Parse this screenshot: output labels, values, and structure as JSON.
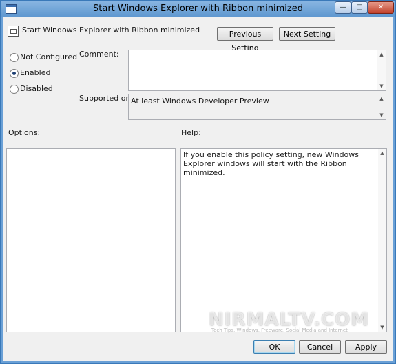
{
  "window": {
    "title": "Start Windows Explorer with Ribbon minimized",
    "icon": "policy-app-icon",
    "controls": {
      "minimize": "—",
      "maximize": "□",
      "close": "✕"
    }
  },
  "policy": {
    "title": "Start Windows Explorer with Ribbon minimized",
    "icon": "policy-setting-icon"
  },
  "nav": {
    "previous": "Previous Setting",
    "next": "Next Setting"
  },
  "state": {
    "options": [
      {
        "label": "Not Configured",
        "selected": false
      },
      {
        "label": "Enabled",
        "selected": true
      },
      {
        "label": "Disabled",
        "selected": false
      }
    ]
  },
  "comment": {
    "label": "Comment:",
    "value": ""
  },
  "supported": {
    "label": "Supported on:",
    "value": "At least Windows Developer Preview"
  },
  "options_panel": {
    "label": "Options:"
  },
  "help_panel": {
    "label": "Help:",
    "text": "If you enable this policy setting, new Windows Explorer windows will start with the Ribbon minimized."
  },
  "buttons": {
    "ok": "OK",
    "cancel": "Cancel",
    "apply": "Apply"
  },
  "watermark": {
    "text": "NIRMALTV.COM",
    "subtext": "Tech Tips, Windows, Freeware, Social Media and Internet"
  }
}
